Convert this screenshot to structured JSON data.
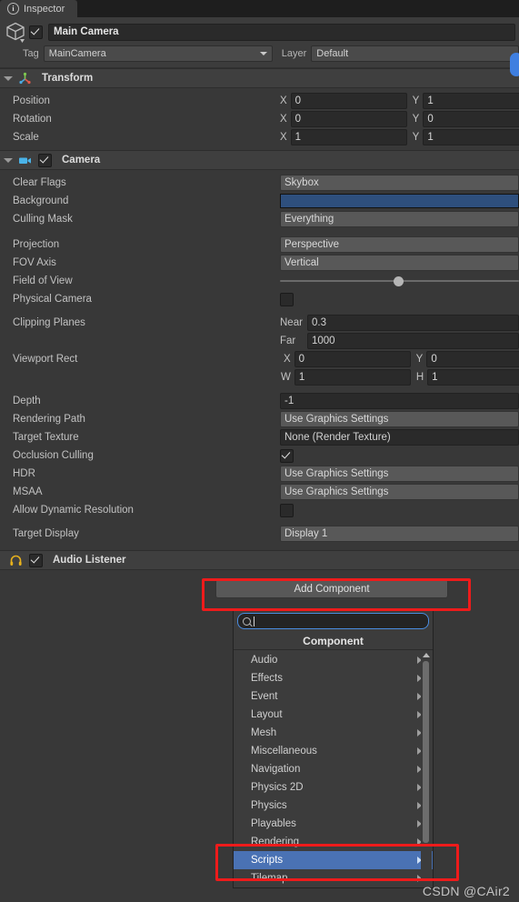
{
  "window": {
    "tab_label": "Inspector",
    "tab_icon": "info-icon"
  },
  "object_header": {
    "icon": "cube-icon",
    "enabled": true,
    "name": "Main Camera",
    "tag_label": "Tag",
    "tag_value": "MainCamera",
    "layer_label": "Layer",
    "layer_value": "Default"
  },
  "components": [
    {
      "title": "Transform",
      "icon": "transform-axis-icon",
      "has_checkbox": false,
      "rows": [
        {
          "label": "Position",
          "fields": [
            {
              "axis": "X",
              "value": "0"
            },
            {
              "axis": "Y",
              "value": "1"
            }
          ]
        },
        {
          "label": "Rotation",
          "fields": [
            {
              "axis": "X",
              "value": "0"
            },
            {
              "axis": "Y",
              "value": "0"
            }
          ]
        },
        {
          "label": "Scale",
          "fields": [
            {
              "axis": "X",
              "value": "1"
            },
            {
              "axis": "Y",
              "value": "1"
            }
          ]
        }
      ]
    },
    {
      "title": "Camera",
      "icon": "camera-icon",
      "has_checkbox": true,
      "enabled": true
    },
    {
      "title": "Audio Listener",
      "icon": "headphones-icon",
      "has_checkbox": true,
      "enabled": true
    }
  ],
  "camera_props": {
    "clear_flags_label": "Clear Flags",
    "clear_flags_value": "Skybox",
    "background_label": "Background",
    "background_color": "#2e4f7d",
    "culling_mask_label": "Culling Mask",
    "culling_mask_value": "Everything",
    "projection_label": "Projection",
    "projection_value": "Perspective",
    "fov_axis_label": "FOV Axis",
    "fov_axis_value": "Vertical",
    "field_of_view_label": "Field of View",
    "field_of_view_slider_pct": 47.5,
    "physical_camera_label": "Physical Camera",
    "physical_camera_checked": false,
    "clipping_planes_label": "Clipping Planes",
    "near_label": "Near",
    "near_value": "0.3",
    "far_label": "Far",
    "far_value": "1000",
    "viewport_rect_label": "Viewport Rect",
    "viewport_x_label": "X",
    "viewport_x_value": "0",
    "viewport_y_label": "Y",
    "viewport_y_value": "0",
    "viewport_w_label": "W",
    "viewport_w_value": "1",
    "viewport_h_label": "H",
    "viewport_h_value": "1",
    "depth_label": "Depth",
    "depth_value": "-1",
    "rendering_path_label": "Rendering Path",
    "rendering_path_value": "Use Graphics Settings",
    "target_texture_label": "Target Texture",
    "target_texture_value": "None (Render Texture)",
    "occlusion_culling_label": "Occlusion Culling",
    "occlusion_culling_checked": true,
    "hdr_label": "HDR",
    "hdr_value": "Use Graphics Settings",
    "msaa_label": "MSAA",
    "msaa_value": "Use Graphics Settings",
    "allow_dynamic_resolution_label": "Allow Dynamic Resolution",
    "allow_dynamic_resolution_checked": false,
    "target_display_label": "Target Display",
    "target_display_value": "Display 1"
  },
  "add_component": {
    "button_label": "Add Component",
    "search_value": "",
    "search_placeholder": "",
    "popup_title": "Component",
    "menu_items": [
      {
        "label": "Audio",
        "selected": false
      },
      {
        "label": "Effects",
        "selected": false
      },
      {
        "label": "Event",
        "selected": false
      },
      {
        "label": "Layout",
        "selected": false
      },
      {
        "label": "Mesh",
        "selected": false
      },
      {
        "label": "Miscellaneous",
        "selected": false
      },
      {
        "label": "Navigation",
        "selected": false
      },
      {
        "label": "Physics 2D",
        "selected": false
      },
      {
        "label": "Physics",
        "selected": false
      },
      {
        "label": "Playables",
        "selected": false
      },
      {
        "label": "Rendering",
        "selected": false
      },
      {
        "label": "Scripts",
        "selected": true
      },
      {
        "label": "Tilemap",
        "selected": false
      }
    ]
  },
  "annotations": {
    "highlight_color": "#ee1b1b",
    "watermark": "CSDN @CAir2"
  }
}
